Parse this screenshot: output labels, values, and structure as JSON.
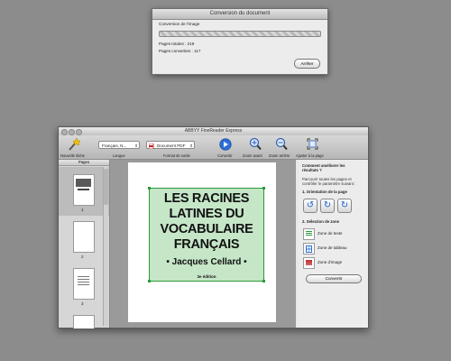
{
  "progress_dialog": {
    "title": "Conversion du document",
    "status": "Conversion de l'image",
    "total_pages": "Pages totales : 219",
    "converted_pages": "Pages converties : 117",
    "stop_button": "Arrêter"
  },
  "main_window": {
    "title": "ABBYY FineReader Express",
    "toolbar": {
      "new_task_label": "Nouvelle tâche",
      "language_label": "Langue",
      "language_value": "Français, N...",
      "output_format_label": "Format de sortie",
      "output_format_value": "Document PDF",
      "convert_label": "Convertir",
      "zoom_in_label": "Zoom avant",
      "zoom_out_label": "Zoom arrière",
      "fit_page_label": "Ajuster à la page"
    },
    "pages_panel": {
      "header": "Pages",
      "thumbnails": [
        {
          "number": "1",
          "text": "LES RACINES LATINES DU VOCABULAIRE FRANÇAIS"
        },
        {
          "number": "2",
          "text": ""
        },
        {
          "number": "3",
          "text": ""
        }
      ]
    },
    "page_image": {
      "title_lines": [
        "LES RACINES",
        "LATINES DU",
        "VOCABULAIRE",
        "FRANÇAIS"
      ],
      "author": "• Jacques Cellard •",
      "edition": "3e édition"
    },
    "task_panel": {
      "heading": [
        "Comment améliorer les",
        "résultats ?"
      ],
      "intro": [
        "Parcourir toutes les pages et",
        "contrôler le paramètre suivant :"
      ],
      "step1": "1. Orientation de la page",
      "step2": "2. Sélection de zone",
      "zones": [
        "Zone de texte",
        "Zone de tableau",
        "Zone d'image"
      ],
      "convert_button": "Convertir"
    }
  }
}
